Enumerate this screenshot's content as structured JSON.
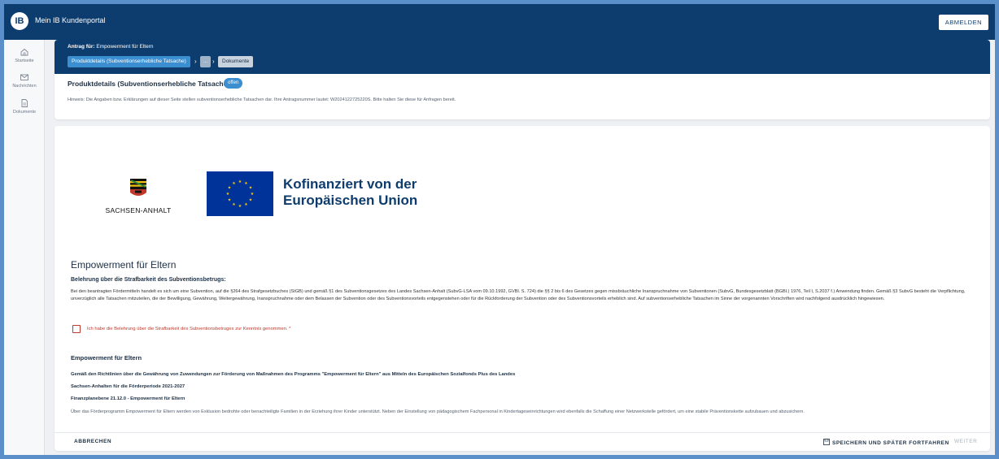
{
  "topbar": {
    "logo_text": "IB",
    "app_title": "Mein IB Kundenportal",
    "logout_label": "ABMELDEN"
  },
  "sidebar": {
    "items": [
      {
        "label": "Startseite",
        "icon": "home-icon"
      },
      {
        "label": "Nachrichten",
        "icon": "mail-icon"
      },
      {
        "label": "Dokumente",
        "icon": "document-icon"
      }
    ]
  },
  "header": {
    "antrag_prefix": "Antrag für:",
    "antrag_name": "Empowerment für Eltern",
    "breadcrumbs": [
      "Produktdetails (Subventionserhebliche Tatsache)",
      "...",
      "Dokumente"
    ],
    "subtitle": "Produktdetails (Subventionserhebliche Tatsache)",
    "status_badge": "offen",
    "hint": "Hinweis: Die Angaben bzw. Erklärungen auf dieser Seite stellen subventionserhebliche Tatsachen dar. Ihre Antragsnummer lautet: W2024122725220S. Bitte halten Sie diese für Anfragen bereit."
  },
  "logos": {
    "sachsen_anhalt_label": "SACHSEN-ANHALT",
    "eu_text_line1": "Kofinanziert von der",
    "eu_text_line2": "Europäischen Union"
  },
  "main": {
    "title": "Empowerment für Eltern",
    "belehrung_heading": "Belehrung über die Strafbarkeit des Subventionsbetrugs:",
    "belehrung_text": "Bei den beantragten Fördermitteln handelt es sich um eine Subvention, auf die §264 des Strafgesetzbuches (StGB) und gemäß §1 des Subventionsgesetzes des Landes Sachsen-Anhalt (SubvG-LSA vom 09.10.1992, GVBl. S. 724) die §§ 2 bis 6 des Gesetzes gegen missbräuchliche Inanspruchnahme von Subventionen (SubvG, Bundesgesetzblatt (BGBl.) 1976, Teil I, S.2037 f.) Anwendung finden. Gemäß §3 SubvG besteht die Verpflichtung, unverzüglich alle Tatsachen mitzuteilen, die der Bewilligung, Gewährung, Weitergewährung, Inanspruchnahme oder dem Belassen der Subvention oder des Subventionsvorteils entgegenstehen oder für die Rückforderung der Subvention oder des Subventionsvorteils erheblich sind. Auf subventionserhebliche Tatsachen im Sinne der vorgenannten Vorschriften wird nachfolgend ausdrücklich hingewiesen.",
    "checkbox_label": "Ich habe die Belehrung über die Strafbarkeit des Subventionsbetruges zur Kenntnis genommen. *",
    "empowerment_heading": "Empowerment für Eltern",
    "info_lines": [
      "Gemäß den Richtlinien über die Gewährung von Zuwendungen zur Förderung von Maßnahmen des Programms \"Empowerment für Eltern\" aus Mitteln des Europäischen Sozialfonds Plus des Landes",
      "Sachsen-Anhalten für die Förderperiode 2021-2027",
      "Finanzplanebene 21.12.0 - Empowerment für Eltern"
    ],
    "info_text": "Über das Förderprogramm Empowerment für Eltern werden von Exklusion bedrohte oder benachteiligte Familien in der Erziehung ihrer Kinder unterstützt. Neben der Einstellung von pädagogischem Fachpersonal in Kindertageseinrichtungen wird ebenfalls die Schaffung einer Netzwerkstelle gefördert, um eine stabile Präventionskette aufzubauen und abzusichern."
  },
  "footer": {
    "cancel_label": "ABBRECHEN",
    "save_label": "SPEICHERN UND SPÄTER FORTFAHREN",
    "next_label": "WEITER"
  }
}
